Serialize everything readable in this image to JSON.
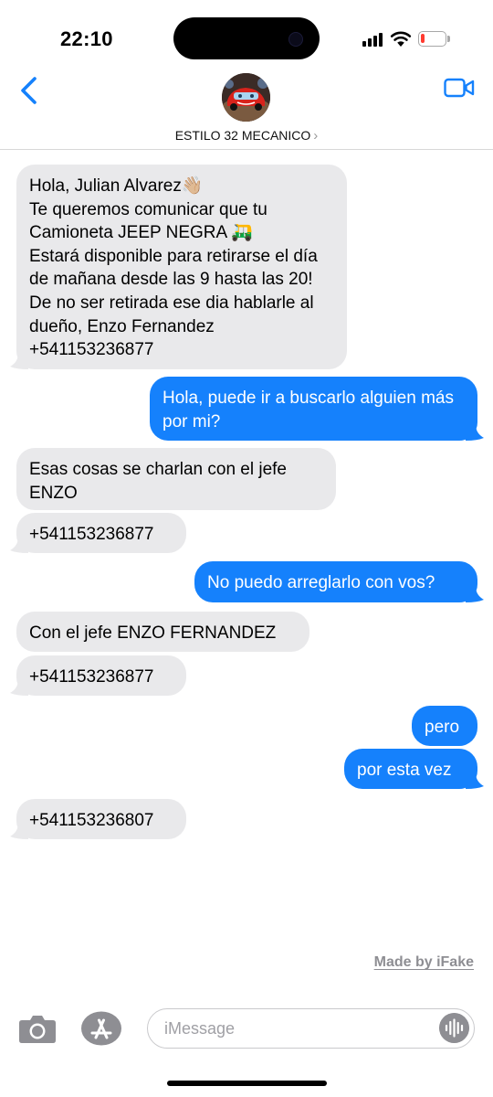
{
  "status_bar": {
    "time": "22:10",
    "battery_level": 0.18,
    "battery_color": "#ff3b30"
  },
  "header": {
    "contact_name": "ESTILO 32 MECANICO",
    "chevron": "›",
    "back_icon": "chevron-left-icon",
    "video_icon": "video-camera-icon"
  },
  "messages": [
    {
      "direction": "incoming",
      "text": "Hola, Julian Alvarez👋🏼\nTe queremos comunicar que tu Camioneta JEEP NEGRA 🛺\nEstará disponible para retirarse el día de mañana desde las 9 hasta las 20! De no ser retirada ese dia hablarle al dueño, Enzo Fernandez +541153236877"
    },
    {
      "direction": "outgoing",
      "text": "Hola, puede ir a buscarlo alguien más por mi?"
    },
    {
      "direction": "incoming",
      "text": "Esas cosas se charlan con el jefe ENZO"
    },
    {
      "direction": "incoming",
      "text": "+541153236877"
    },
    {
      "direction": "outgoing",
      "text": "No puedo arreglarlo con vos?"
    },
    {
      "direction": "incoming",
      "text": "Con el jefe ENZO FERNANDEZ"
    },
    {
      "direction": "incoming",
      "text": "+541153236877"
    },
    {
      "direction": "outgoing",
      "text": "pero"
    },
    {
      "direction": "outgoing",
      "text": "por esta vez"
    },
    {
      "direction": "incoming",
      "text": "+541153236807"
    }
  ],
  "watermark": "Made by iFake",
  "input_bar": {
    "placeholder": "iMessage",
    "camera_icon": "camera-icon",
    "apps_icon": "app-store-icon",
    "audio_icon": "audio-waveform-icon"
  },
  "colors": {
    "outgoing_bubble": "#1581fc",
    "incoming_bubble": "#e9e9eb",
    "accent": "#1581fc"
  }
}
